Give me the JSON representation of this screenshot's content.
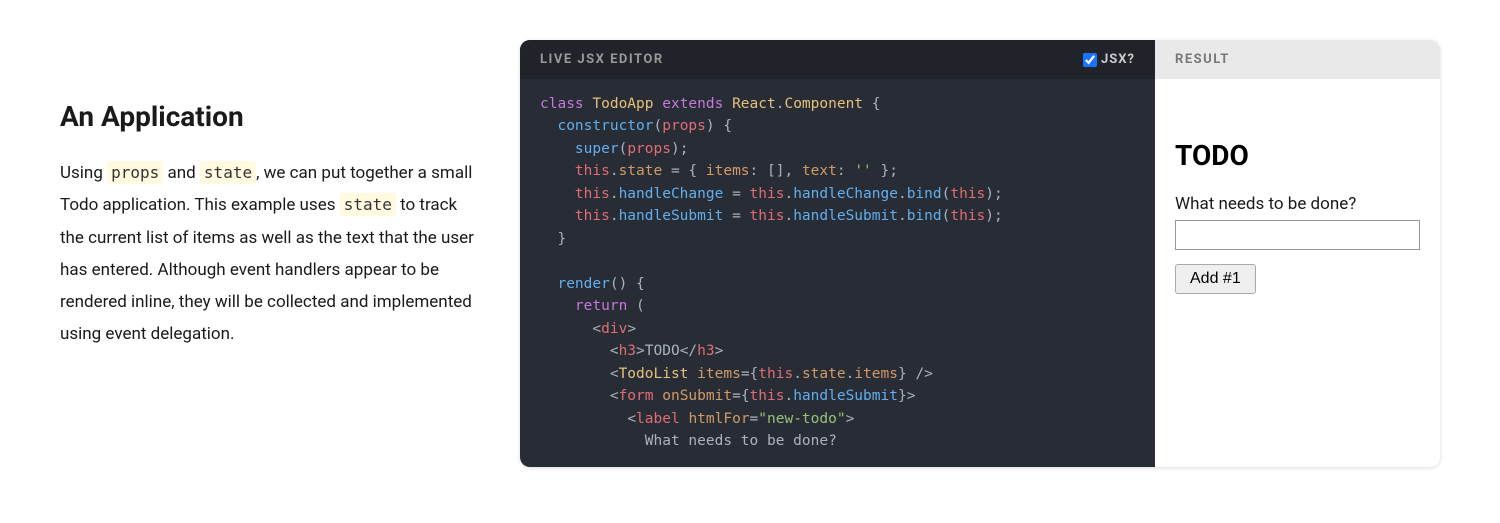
{
  "intro": {
    "heading": "An Application",
    "p1_pre": "Using ",
    "code1": "props",
    "p1_mid1": " and ",
    "code2": "state",
    "p1_mid2": ", we can put together a small Todo application. This example uses ",
    "code3": "state",
    "p1_tail": " to track the current list of items as well as the text that the user has entered. Although event handlers appear to be rendered inline, they will be collected and implemented using event delegation."
  },
  "editor": {
    "title": "LIVE JSX EDITOR",
    "jsx_label": "JSX?",
    "jsx_checked": true,
    "lines": [
      {
        "segs": [
          {
            "t": "class ",
            "c": "tok-kw"
          },
          {
            "t": "TodoApp ",
            "c": "tok-cls"
          },
          {
            "t": "extends ",
            "c": "tok-kw"
          },
          {
            "t": "React",
            "c": "tok-cls"
          },
          {
            "t": ".",
            "c": "tok-pn"
          },
          {
            "t": "Component ",
            "c": "tok-cls"
          },
          {
            "t": "{",
            "c": "tok-pn"
          }
        ]
      },
      {
        "segs": [
          {
            "t": "  ",
            "c": "tok-pn"
          },
          {
            "t": "constructor",
            "c": "tok-fn"
          },
          {
            "t": "(",
            "c": "tok-pn"
          },
          {
            "t": "props",
            "c": "tok-var"
          },
          {
            "t": ") {",
            "c": "tok-pn"
          }
        ]
      },
      {
        "segs": [
          {
            "t": "    ",
            "c": "tok-pn"
          },
          {
            "t": "super",
            "c": "tok-fn"
          },
          {
            "t": "(",
            "c": "tok-pn"
          },
          {
            "t": "props",
            "c": "tok-var"
          },
          {
            "t": ");",
            "c": "tok-pn"
          }
        ]
      },
      {
        "segs": [
          {
            "t": "    ",
            "c": "tok-pn"
          },
          {
            "t": "this",
            "c": "tok-this"
          },
          {
            "t": ".",
            "c": "tok-pn"
          },
          {
            "t": "state",
            "c": "tok-prop"
          },
          {
            "t": " = { ",
            "c": "tok-pn"
          },
          {
            "t": "items",
            "c": "tok-prop"
          },
          {
            "t": ": [], ",
            "c": "tok-pn"
          },
          {
            "t": "text",
            "c": "tok-prop"
          },
          {
            "t": ": ",
            "c": "tok-pn"
          },
          {
            "t": "''",
            "c": "tok-str"
          },
          {
            "t": " };",
            "c": "tok-pn"
          }
        ]
      },
      {
        "segs": [
          {
            "t": "    ",
            "c": "tok-pn"
          },
          {
            "t": "this",
            "c": "tok-this"
          },
          {
            "t": ".",
            "c": "tok-pn"
          },
          {
            "t": "handleChange",
            "c": "tok-fn"
          },
          {
            "t": " = ",
            "c": "tok-pn"
          },
          {
            "t": "this",
            "c": "tok-this"
          },
          {
            "t": ".",
            "c": "tok-pn"
          },
          {
            "t": "handleChange",
            "c": "tok-fn"
          },
          {
            "t": ".",
            "c": "tok-pn"
          },
          {
            "t": "bind",
            "c": "tok-fn"
          },
          {
            "t": "(",
            "c": "tok-pn"
          },
          {
            "t": "this",
            "c": "tok-this"
          },
          {
            "t": ");",
            "c": "tok-pn"
          }
        ]
      },
      {
        "segs": [
          {
            "t": "    ",
            "c": "tok-pn"
          },
          {
            "t": "this",
            "c": "tok-this"
          },
          {
            "t": ".",
            "c": "tok-pn"
          },
          {
            "t": "handleSubmit",
            "c": "tok-fn"
          },
          {
            "t": " = ",
            "c": "tok-pn"
          },
          {
            "t": "this",
            "c": "tok-this"
          },
          {
            "t": ".",
            "c": "tok-pn"
          },
          {
            "t": "handleSubmit",
            "c": "tok-fn"
          },
          {
            "t": ".",
            "c": "tok-pn"
          },
          {
            "t": "bind",
            "c": "tok-fn"
          },
          {
            "t": "(",
            "c": "tok-pn"
          },
          {
            "t": "this",
            "c": "tok-this"
          },
          {
            "t": ");",
            "c": "tok-pn"
          }
        ]
      },
      {
        "segs": [
          {
            "t": "  }",
            "c": "tok-pn"
          }
        ]
      },
      {
        "segs": [
          {
            "t": " ",
            "c": "tok-pn"
          }
        ]
      },
      {
        "segs": [
          {
            "t": "  ",
            "c": "tok-pn"
          },
          {
            "t": "render",
            "c": "tok-fn"
          },
          {
            "t": "() {",
            "c": "tok-pn"
          }
        ]
      },
      {
        "segs": [
          {
            "t": "    ",
            "c": "tok-pn"
          },
          {
            "t": "return ",
            "c": "tok-kw"
          },
          {
            "t": "(",
            "c": "tok-pn"
          }
        ]
      },
      {
        "segs": [
          {
            "t": "      ",
            "c": "tok-pn"
          },
          {
            "t": "<",
            "c": "tok-tagbr"
          },
          {
            "t": "div",
            "c": "tok-tag"
          },
          {
            "t": ">",
            "c": "tok-tagbr"
          }
        ]
      },
      {
        "segs": [
          {
            "t": "        ",
            "c": "tok-pn"
          },
          {
            "t": "<",
            "c": "tok-tagbr"
          },
          {
            "t": "h3",
            "c": "tok-tag"
          },
          {
            "t": ">",
            "c": "tok-tagbr"
          },
          {
            "t": "TODO",
            "c": "tok-pn"
          },
          {
            "t": "</",
            "c": "tok-tagbr"
          },
          {
            "t": "h3",
            "c": "tok-tag"
          },
          {
            "t": ">",
            "c": "tok-tagbr"
          }
        ]
      },
      {
        "segs": [
          {
            "t": "        ",
            "c": "tok-pn"
          },
          {
            "t": "<",
            "c": "tok-tagbr"
          },
          {
            "t": "TodoList ",
            "c": "tok-cls"
          },
          {
            "t": "items",
            "c": "tok-attr"
          },
          {
            "t": "=",
            "c": "tok-pn"
          },
          {
            "t": "{",
            "c": "tok-pn"
          },
          {
            "t": "this",
            "c": "tok-this"
          },
          {
            "t": ".",
            "c": "tok-pn"
          },
          {
            "t": "state",
            "c": "tok-prop"
          },
          {
            "t": ".",
            "c": "tok-pn"
          },
          {
            "t": "items",
            "c": "tok-prop"
          },
          {
            "t": "}",
            "c": "tok-pn"
          },
          {
            "t": " />",
            "c": "tok-tagbr"
          }
        ]
      },
      {
        "segs": [
          {
            "t": "        ",
            "c": "tok-pn"
          },
          {
            "t": "<",
            "c": "tok-tagbr"
          },
          {
            "t": "form ",
            "c": "tok-tag"
          },
          {
            "t": "onSubmit",
            "c": "tok-attr"
          },
          {
            "t": "=",
            "c": "tok-pn"
          },
          {
            "t": "{",
            "c": "tok-pn"
          },
          {
            "t": "this",
            "c": "tok-this"
          },
          {
            "t": ".",
            "c": "tok-pn"
          },
          {
            "t": "handleSubmit",
            "c": "tok-fn"
          },
          {
            "t": "}",
            "c": "tok-pn"
          },
          {
            "t": ">",
            "c": "tok-tagbr"
          }
        ]
      },
      {
        "segs": [
          {
            "t": "          ",
            "c": "tok-pn"
          },
          {
            "t": "<",
            "c": "tok-tagbr"
          },
          {
            "t": "label ",
            "c": "tok-tag"
          },
          {
            "t": "htmlFor",
            "c": "tok-attr"
          },
          {
            "t": "=",
            "c": "tok-pn"
          },
          {
            "t": "\"new-todo\"",
            "c": "tok-str"
          },
          {
            "t": ">",
            "c": "tok-tagbr"
          }
        ]
      },
      {
        "segs": [
          {
            "t": "            What needs to be done?",
            "c": "tok-pn"
          }
        ]
      }
    ]
  },
  "result": {
    "title": "RESULT",
    "heading": "TODO",
    "label": "What needs to be done?",
    "input_value": "",
    "button": "Add #1"
  }
}
